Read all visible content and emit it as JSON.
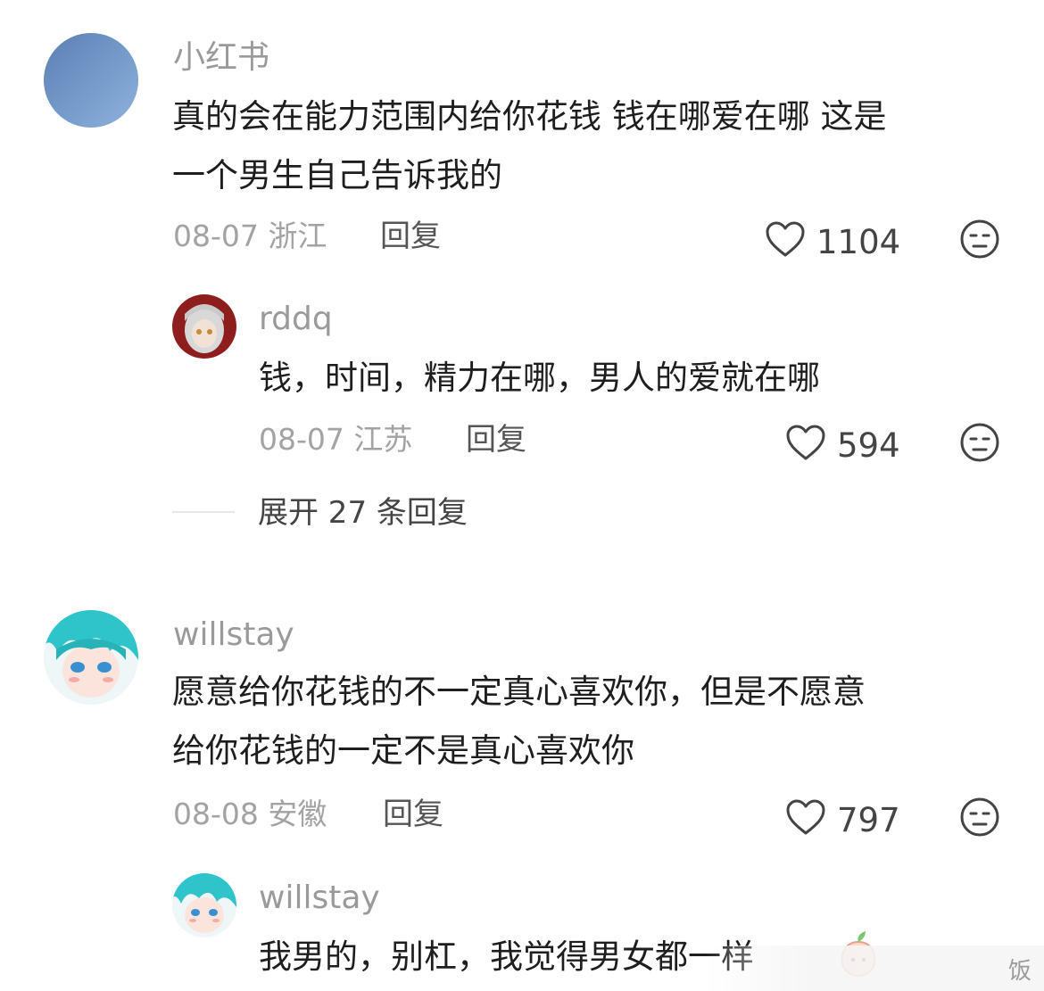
{
  "comments": [
    {
      "username": "小红书",
      "text_lines": [
        "真的会在能力范围内给你花钱 钱在哪爱在哪 这是",
        "一个男生自己告诉我的"
      ],
      "date": "08-07",
      "location": "浙江",
      "reply_label": "回复",
      "likes": "1104",
      "avatar_color": "#6f95c4",
      "replies": [
        {
          "username": "rddq",
          "text": "钱，时间，精力在哪，男人的爱就在哪",
          "date": "08-07",
          "location": "江苏",
          "reply_label": "回复",
          "likes": "594"
        }
      ],
      "expand_label": "展开 27 条回复"
    },
    {
      "username": "willstay",
      "text_lines": [
        "愿意给你花钱的不一定真心喜欢你，但是不愿意",
        "给你花钱的一定不是真心喜欢你"
      ],
      "date": "08-08",
      "location": "安徽",
      "reply_label": "回复",
      "likes": "797",
      "avatar_color": "#2fc4c9",
      "replies": [
        {
          "username": "willstay",
          "text": "我男的，别杠，我觉得男女都一样"
        }
      ]
    }
  ],
  "watermark": "饭"
}
